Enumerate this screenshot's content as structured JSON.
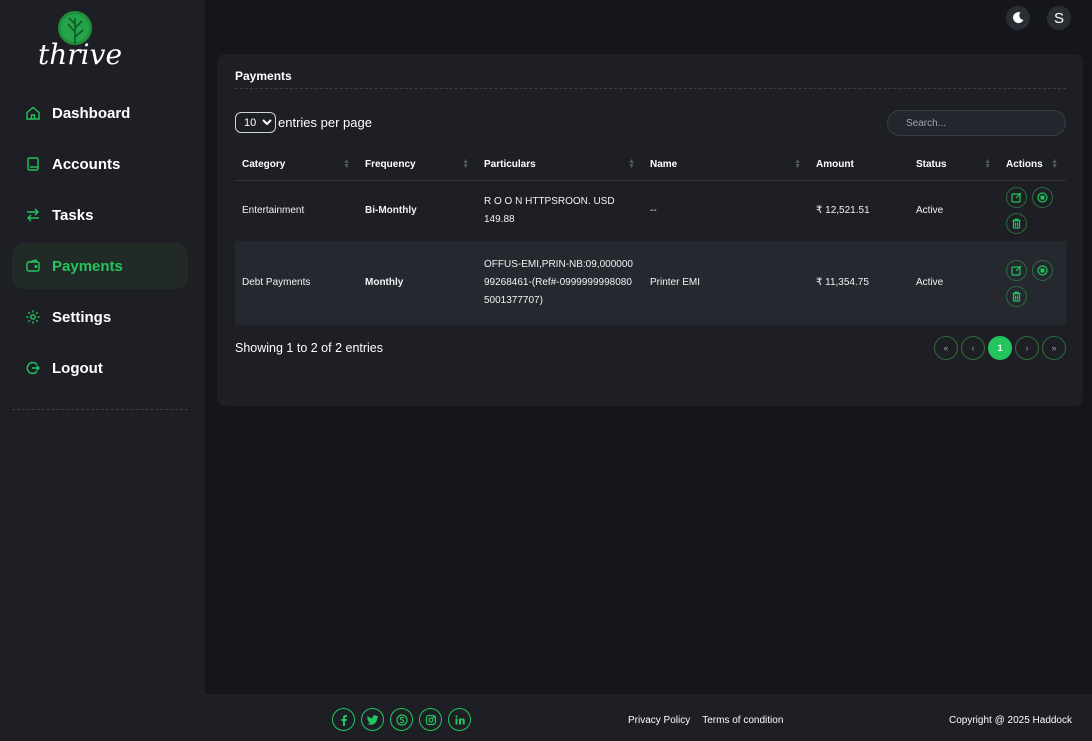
{
  "brand": {
    "name": "thrive",
    "accent": "#22c55e"
  },
  "sidebar": {
    "items": [
      {
        "label": "Dashboard",
        "icon": "home-icon"
      },
      {
        "label": "Accounts",
        "icon": "book-icon"
      },
      {
        "label": "Tasks",
        "icon": "arrows-swap-icon"
      },
      {
        "label": "Payments",
        "icon": "wallet-icon",
        "active": true
      },
      {
        "label": "Settings",
        "icon": "gear-icon"
      },
      {
        "label": "Logout",
        "icon": "logout-icon"
      }
    ]
  },
  "header": {
    "theme_icon": "moon-icon",
    "avatar_initial": "S"
  },
  "card": {
    "title": "Payments"
  },
  "controls": {
    "per_page_value": "10",
    "per_page_label": "entries per page",
    "search_placeholder": "Search..."
  },
  "table": {
    "columns": [
      "Category",
      "Frequency",
      "Particulars",
      "Name",
      "Amount",
      "Status",
      "Actions"
    ],
    "rows": [
      {
        "category": "Entertainment",
        "frequency": "Bi-Monthly",
        "particulars": "R O O N HTTPSROON. USD 149.88",
        "name": "--",
        "amount": "₹ 12,521.51",
        "status": "Active"
      },
      {
        "category": "Debt Payments",
        "frequency": "Monthly",
        "particulars": "OFFUS-EMI,PRIN-NB:09,00000099268461-(Ref#-09999999980805001377707)",
        "name": "Printer EMI",
        "amount": "₹ 11,354.75",
        "status": "Active"
      }
    ]
  },
  "pagination": {
    "summary": "Showing 1 to 2 of 2 entries",
    "first": "«",
    "prev": "‹",
    "current": "1",
    "next": "›",
    "last": "»"
  },
  "footer": {
    "socials": [
      "facebook-icon",
      "twitter-icon",
      "skype-icon",
      "instagram-icon",
      "linkedin-icon"
    ],
    "links": [
      "Privacy Policy",
      "Terms of condition"
    ],
    "copyright": "Copyright @ 2025 Haddock"
  }
}
